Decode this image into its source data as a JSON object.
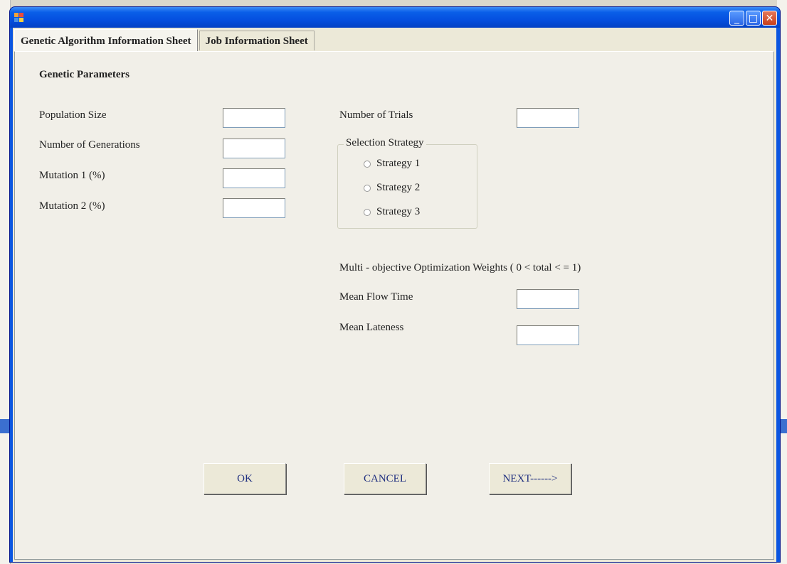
{
  "window": {
    "title": ""
  },
  "tabs": [
    {
      "label": "Genetic Algorithm Information Sheet",
      "active": true
    },
    {
      "label": "Job Information Sheet",
      "active": false
    }
  ],
  "section": {
    "heading": "Genetic Parameters"
  },
  "left_fields": [
    {
      "label": "Population Size",
      "value": ""
    },
    {
      "label": "Number of Generations",
      "value": ""
    },
    {
      "label": "Mutation 1 (%)",
      "value": ""
    },
    {
      "label": "Mutation 2 (%)",
      "value": ""
    }
  ],
  "trials": {
    "label": "Number of Trials",
    "value": ""
  },
  "selection": {
    "legend": "Selection Strategy",
    "options": [
      "Strategy 1",
      "Strategy 2",
      "Strategy 3"
    ]
  },
  "weights": {
    "heading": "Multi - objective Optimization Weights ( 0 < total < = 1)",
    "fields": [
      {
        "label": "Mean Flow Time",
        "value": ""
      },
      {
        "label": "Mean Lateness",
        "value": ""
      }
    ]
  },
  "buttons": {
    "ok": "OK",
    "cancel": "CANCEL",
    "next": "NEXT------>"
  },
  "colors": {
    "titlebar": "#0550e0",
    "client": "#ece9d8",
    "button_text": "#203080"
  }
}
